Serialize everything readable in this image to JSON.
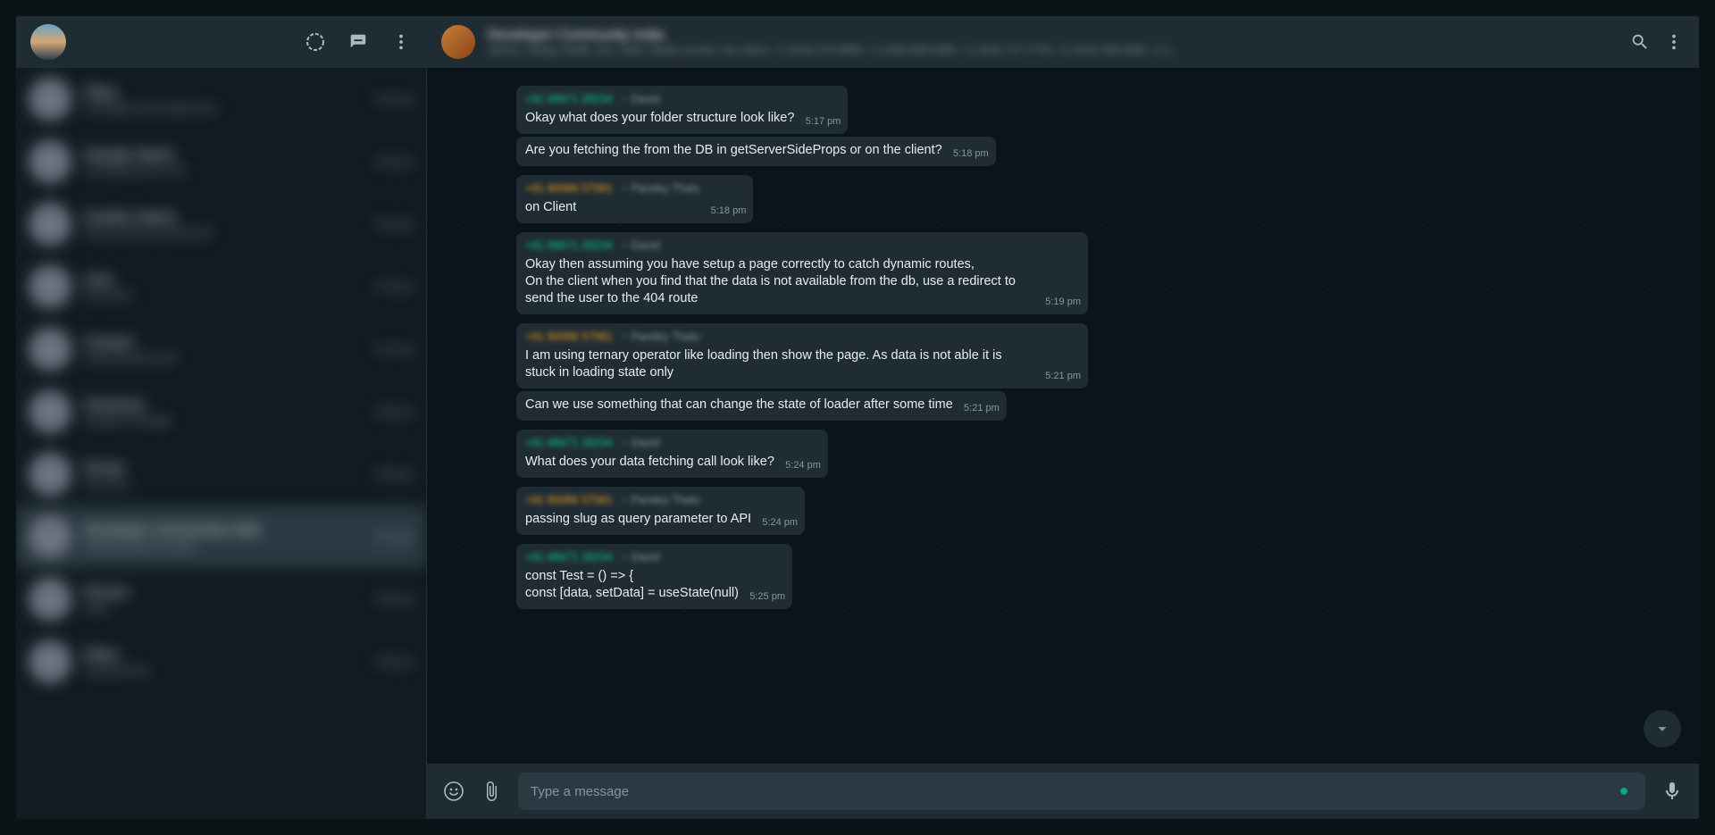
{
  "header": {
    "group_title": "Developer Community India",
    "group_subtitle": "names, chirag, hardik, ravi, sales, dhelly, kuumir, ravi, tibna, +1 (215) 270-4990, +1 (249) 995-0892, +1 (315) 717-7778, +1 (316) 789-4036, +1 (..."
  },
  "sidebar_chats": [
    {
      "name": "Okay",
      "preview": "message text sample one",
      "time": "5:24 pm"
    },
    {
      "name": "Sample Name",
      "preview": "something here text",
      "time": "5:20 pm"
    },
    {
      "name": "Another Name",
      "preview": "lorem ipsum preview text",
      "time": "5:18 pm"
    },
    {
      "name": "User",
      "preview": "hey there",
      "time": "5:15 pm"
    },
    {
      "name": "Contact",
      "preview": "emoji preview text",
      "time": "5:10 pm"
    },
    {
      "name": "Someone",
      "preview": "sample message",
      "time": "5:05 pm"
    },
    {
      "name": "Group",
      "preview": "text here",
      "time": "4:58 pm"
    },
    {
      "name": "Developer Community India",
      "preview": "passing slug as query",
      "time": "4:50 pm"
    },
    {
      "name": "Person",
      "preview": "hello",
      "time": "4:40 pm"
    },
    {
      "name": "Other",
      "preview": "msg preview",
      "time": "4:35 pm"
    }
  ],
  "messages": [
    {
      "sender": "+91 98671 28234",
      "alias": "~ David",
      "sender_color": "green",
      "text": "Okay what does your folder structure look like?",
      "time": "5:17 pm",
      "show_sender": true
    },
    {
      "text": "Are you fetching the from the DB in getServerSideProps or on the client?",
      "time": "5:18 pm",
      "show_sender": false
    },
    {
      "sender": "+91 80086 57581",
      "alias": "~ Pandey Thalu",
      "sender_color": "orange",
      "text": "on Client",
      "time": "5:18 pm",
      "show_sender": true
    },
    {
      "sender": "+91 98671 28234",
      "alias": "~ David",
      "sender_color": "green",
      "text": "Okay then assuming you have setup a page correctly to catch dynamic routes,\nOn the client when you find that the data is not available from the db, use a redirect to send the user to the 404 route",
      "time": "5:19 pm",
      "show_sender": true
    },
    {
      "sender": "+91 80086 57581",
      "alias": "~ Pandey Thalu",
      "sender_color": "orange",
      "text": "I am using ternary operator like loading then show the page. As data is not able it is stuck in loading state only",
      "time": "5:21 pm",
      "show_sender": true
    },
    {
      "text": "Can we use something that can change the state of loader after some time",
      "time": "5:21 pm",
      "show_sender": false
    },
    {
      "sender": "+91 98671 28234",
      "alias": "~ David",
      "sender_color": "green",
      "text": "What does your data fetching call look like?",
      "time": "5:24 pm",
      "show_sender": true
    },
    {
      "sender": "+91 80086 57581",
      "alias": "~ Pandey Thalu",
      "sender_color": "orange",
      "text": "passing slug as query parameter to API",
      "time": "5:24 pm",
      "show_sender": true
    },
    {
      "sender": "+91 98671 28234",
      "alias": "~ David",
      "sender_color": "green",
      "text": "const Test = () => {\n    const [data, setData] = useState(null)",
      "time": "5:25 pm",
      "show_sender": true
    }
  ],
  "composer": {
    "placeholder": "Type a message"
  }
}
